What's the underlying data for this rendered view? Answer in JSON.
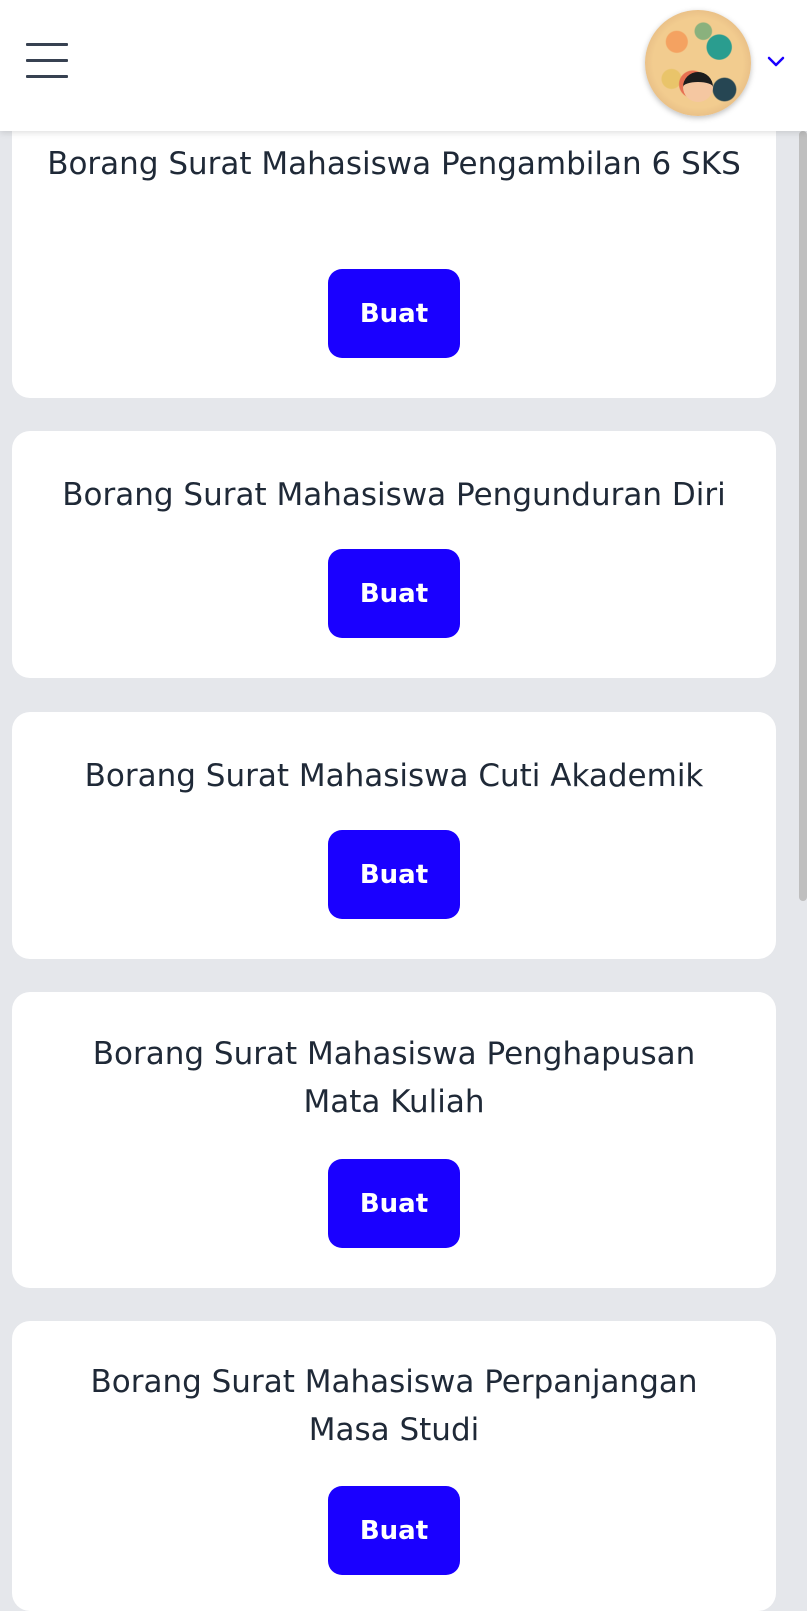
{
  "header": {
    "menu_icon": "hamburger-menu-icon",
    "avatar_icon": "user-avatar",
    "dropdown_icon": "chevron-down-icon",
    "accent_color": "#1a00ff"
  },
  "cards": [
    {
      "title": "Borang Surat Mahasiswa Pengambilan 6 SKS",
      "button_label": "Buat"
    },
    {
      "title": "Borang Surat Mahasiswa Pengunduran Diri",
      "button_label": "Buat"
    },
    {
      "title": "Borang Surat Mahasiswa Cuti Akademik",
      "button_label": "Buat"
    },
    {
      "title": "Borang Surat Mahasiswa Penghapusan Mata Kuliah",
      "button_label": "Buat"
    },
    {
      "title": "Borang Surat Mahasiswa Perpanjangan Masa Studi",
      "button_label": "Buat"
    }
  ]
}
